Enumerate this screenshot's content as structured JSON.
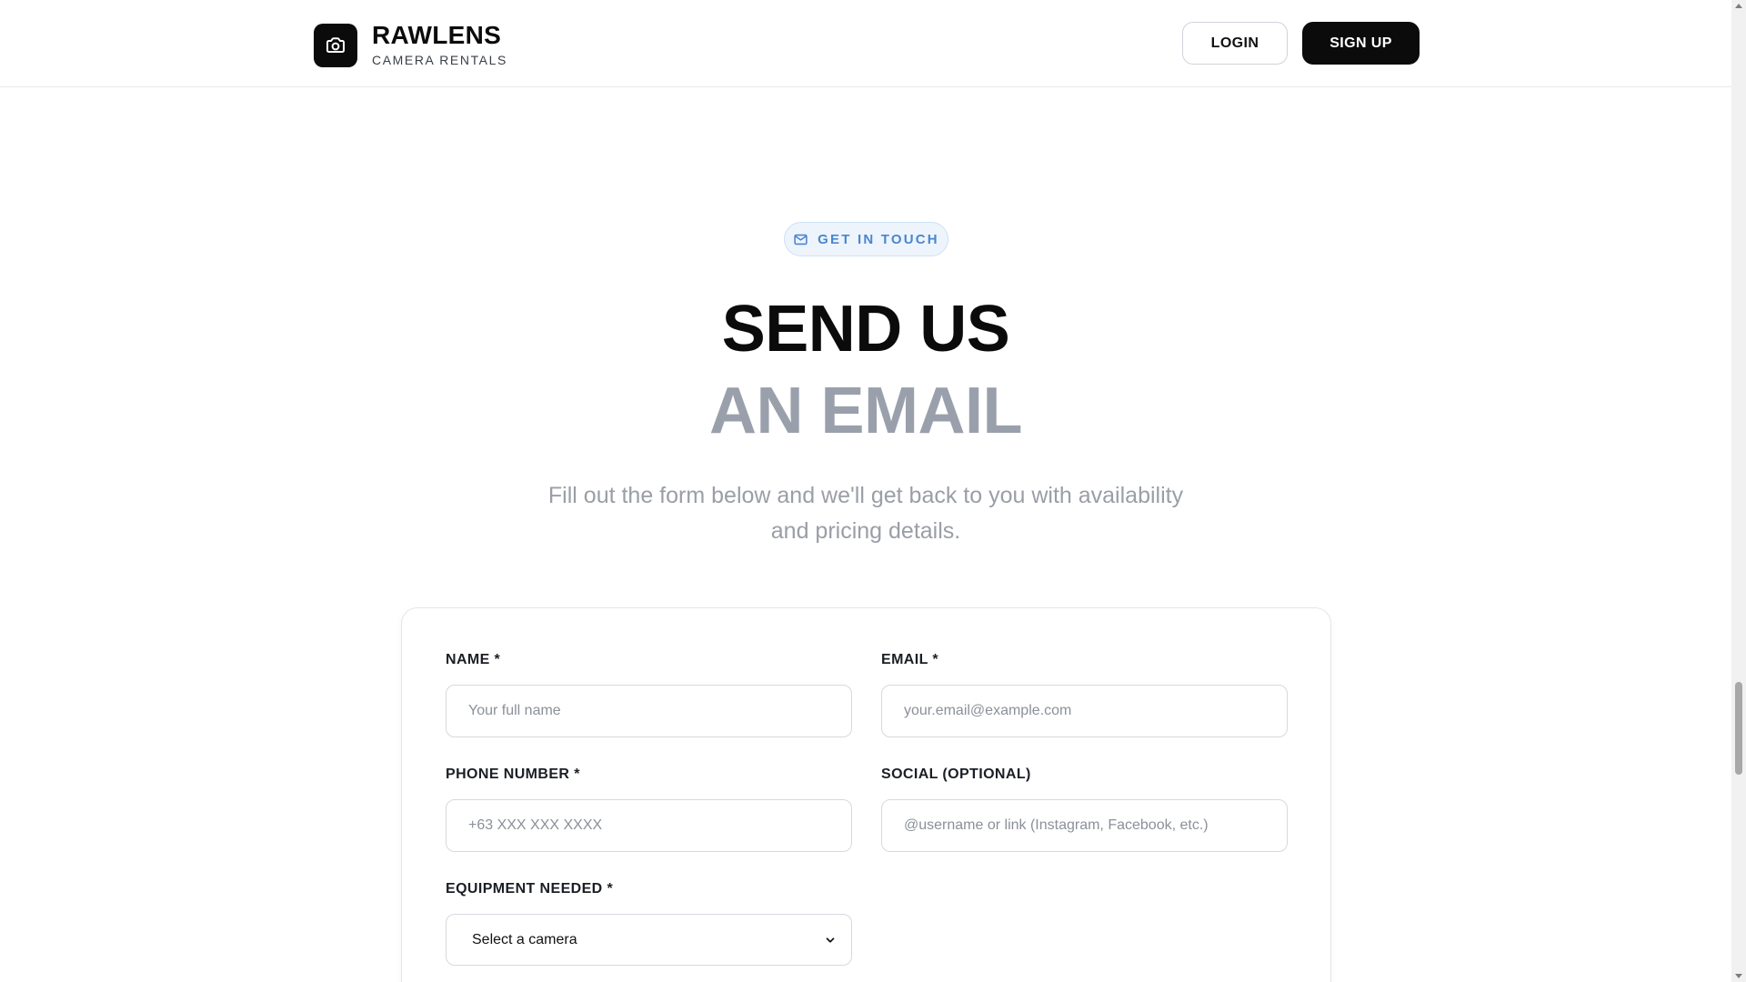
{
  "header": {
    "brand_name": "RAWLENS",
    "brand_sub": "CAMERA RENTALS",
    "logo_icon": "camera-icon",
    "login_label": "LOGIN",
    "signup_label": "SIGN UP"
  },
  "hero": {
    "pill_icon": "mail-icon",
    "pill_label": "GET IN TOUCH",
    "headline_line1": "SEND US",
    "headline_line2": "AN EMAIL",
    "subtext": "Fill out the form below and we'll get back to you with availability and pricing details."
  },
  "form": {
    "name_label": "NAME *",
    "name_placeholder": "Your full name",
    "email_label": "EMAIL *",
    "email_placeholder": "your.email@example.com",
    "phone_label": "PHONE NUMBER *",
    "phone_placeholder": "+63 XXX XXX XXXX",
    "social_label": "SOCIAL (OPTIONAL)",
    "social_placeholder": "@username or link (Instagram, Facebook, etc.)",
    "equipment_label": "EQUIPMENT NEEDED *",
    "equipment_selected": "Select a camera"
  },
  "colors": {
    "primary": "#0b0b0b",
    "accent_blue": "#4a86cf",
    "muted_heading": "#9aa0ab"
  }
}
